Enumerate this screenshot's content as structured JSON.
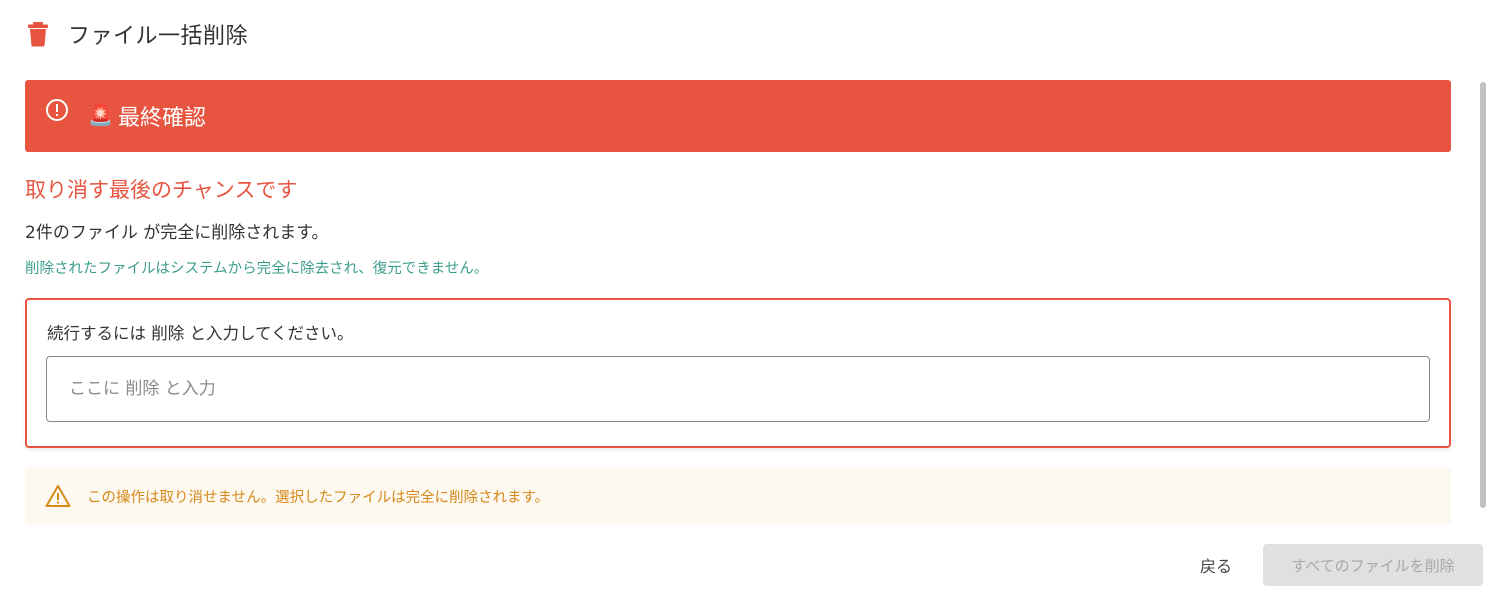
{
  "header": {
    "icon": "trash-icon",
    "title": "ファイル一括削除"
  },
  "banner": {
    "alert_icon": "exclamation-circle-icon",
    "emoji": "🚨",
    "title": "最終確認",
    "color": "#e75541"
  },
  "main": {
    "warning_heading": "取り消す最後のチャンスです",
    "count_text": "2件のファイル が完全に削除されます。",
    "note_text": "削除されたファイルはシステムから完全に除去され、復元できません。",
    "confirm": {
      "label": "続行するには 削除 と入力してください。",
      "input_value": "",
      "input_placeholder": "ここに 削除 と入力"
    },
    "caution": {
      "icon": "warning-triangle-icon",
      "text": "この操作は取り消せません。選択したファイルは完全に削除されます。"
    }
  },
  "footer": {
    "back_label": "戻る",
    "delete_all_label": "すべてのファイルを削除",
    "delete_all_enabled": false
  },
  "colors": {
    "accent": "#e75541",
    "note": "#3c9d8d",
    "caution_text": "#d68a1a",
    "caution_bg": "#fdf8f0"
  }
}
